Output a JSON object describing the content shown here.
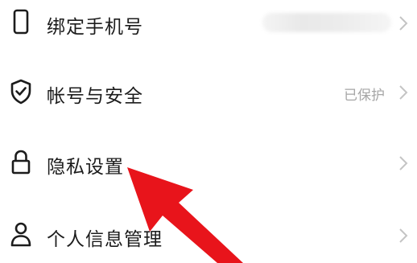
{
  "settings": {
    "rows": [
      {
        "label": "绑定手机号",
        "value": "",
        "icon": "phone-icon"
      },
      {
        "label": "帐号与安全",
        "value": "已保护",
        "icon": "shield-check-icon"
      },
      {
        "label": "隐私设置",
        "value": "",
        "icon": "lock-icon"
      },
      {
        "label": "个人信息管理",
        "value": "",
        "icon": "person-icon"
      }
    ]
  },
  "colors": {
    "text": "#1c1c1c",
    "secondary_text": "#a6a6a6",
    "chevron": "#c4c4c4",
    "annotation_arrow": "#e8141b"
  }
}
